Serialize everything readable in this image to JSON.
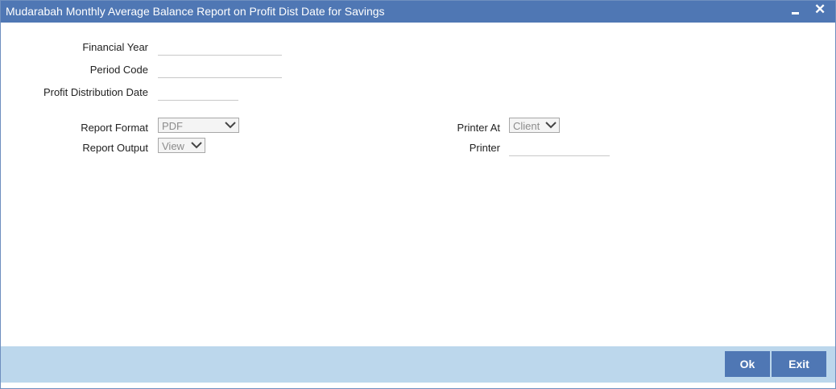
{
  "window": {
    "title": "Mudarabah Monthly Average Balance Report on Profit Dist Date for Savings",
    "close_glyph": "✕"
  },
  "form": {
    "financial_year": {
      "label": "Financial Year",
      "value": ""
    },
    "period_code": {
      "label": "Period Code",
      "value": ""
    },
    "profit_distribution_date": {
      "label": "Profit Distribution Date",
      "value": ""
    },
    "report_format": {
      "label": "Report Format",
      "selected": "PDF"
    },
    "report_output": {
      "label": "Report Output",
      "selected": "View"
    },
    "printer_at": {
      "label": "Printer At",
      "selected": "Client"
    },
    "printer": {
      "label": "Printer",
      "value": ""
    }
  },
  "footer": {
    "ok_label": "Ok",
    "exit_label": "Exit"
  },
  "colors": {
    "titlebar": "#4f77b4",
    "footer": "#bcd7ec",
    "button": "#4f77b4"
  }
}
